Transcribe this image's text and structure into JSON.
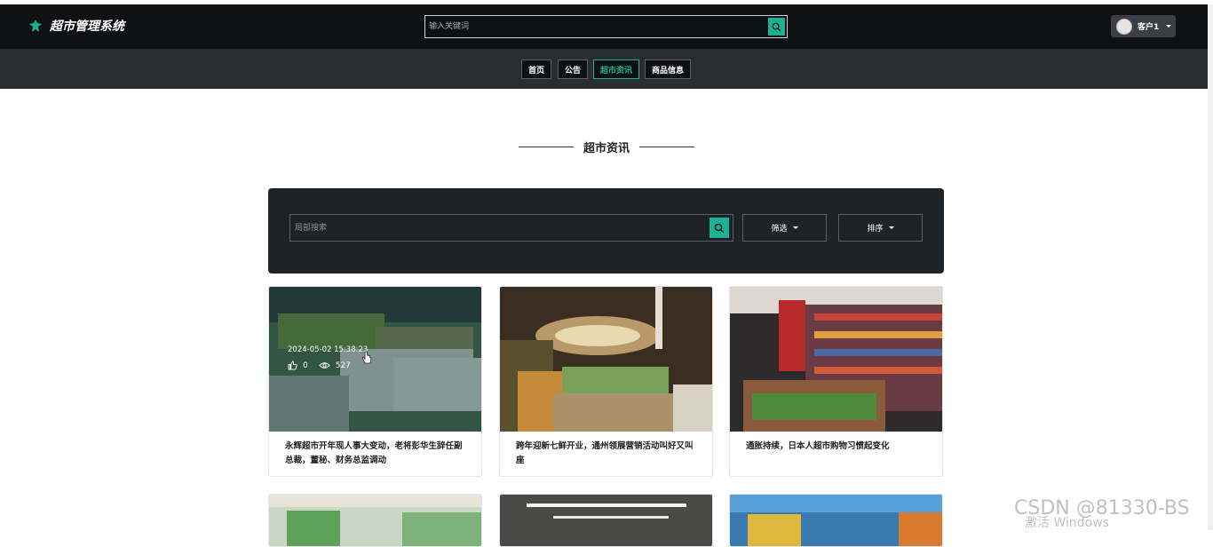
{
  "app": {
    "title": "超市管理系统",
    "logo_icon": "leaf-icon"
  },
  "header": {
    "search": {
      "placeholder": "输入关键词",
      "value": ""
    },
    "user": {
      "name": "客户1"
    }
  },
  "nav": {
    "items": [
      {
        "label": "首页",
        "active": false
      },
      {
        "label": "公告",
        "active": false
      },
      {
        "label": "超市资讯",
        "active": true
      },
      {
        "label": "商品信息",
        "active": false
      }
    ]
  },
  "section": {
    "title": "超市资讯"
  },
  "filter": {
    "search": {
      "placeholder": "局部搜索",
      "value": ""
    },
    "filter_label": "筛选",
    "sort_label": "排序"
  },
  "cards": [
    {
      "title": "永辉超市开年现人事大变动，老将彭华生辞任副总裁，董秘、财务总监调动",
      "date": "2024-05-02 15:38:23",
      "likes": "0",
      "views": "527"
    },
    {
      "title": "跨年迎新七鲜开业，通州领展营销活动叫好又叫座"
    },
    {
      "title": "通胀持续，日本人超市购物习惯起变化"
    }
  ],
  "colors": {
    "accent": "#19b394",
    "header_bg": "#0e1013",
    "subnav_bg": "#2a2d32",
    "panel_bg": "#1f2226"
  },
  "watermark": {
    "csdn": "CSDN @81330-BS",
    "windows": "激活 Windows"
  }
}
